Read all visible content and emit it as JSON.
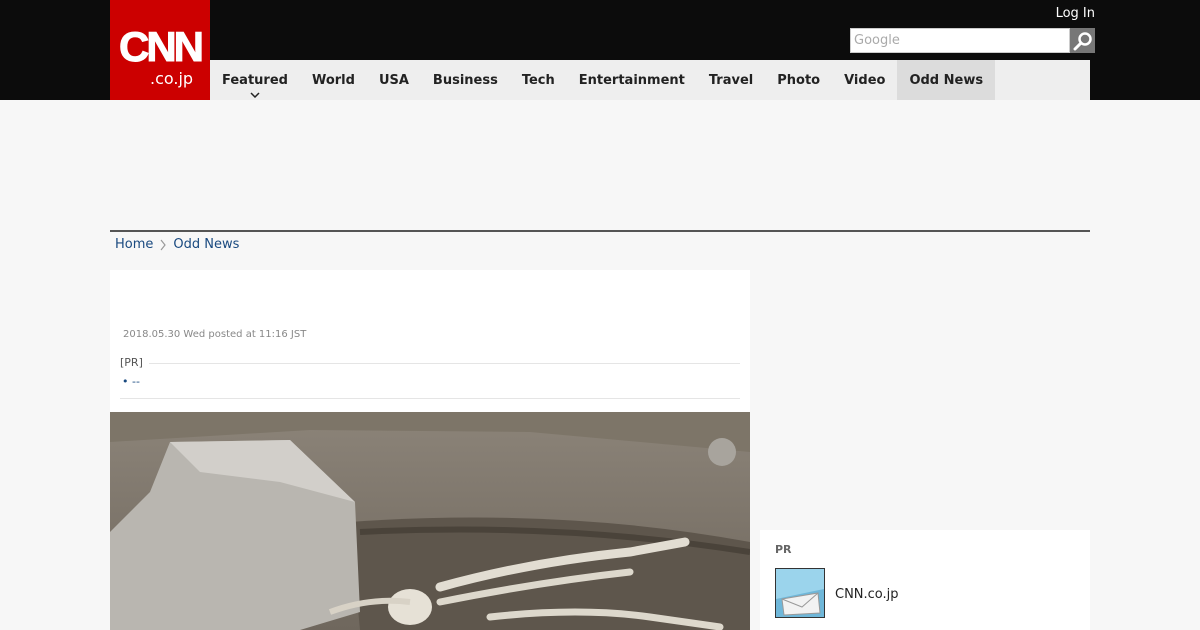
{
  "header": {
    "logo_main": "CNN",
    "logo_sub": ".co.jp",
    "login_label": "Log In",
    "search_placeholder": "Google"
  },
  "nav": {
    "items": [
      "Featured",
      "World",
      "USA",
      "Business",
      "Tech",
      "Entertainment",
      "Travel",
      "Photo",
      "Video",
      "Odd News"
    ],
    "active": "Odd News"
  },
  "breadcrumb": {
    "home": "Home",
    "current": "Odd News"
  },
  "article": {
    "dateline": "2018.05.30 Wed posted at 11:16 JST",
    "pr_label": "[PR]",
    "pr_link": "--"
  },
  "sidebar": {
    "pr_label": "PR",
    "item_label": "CNN.co.jp"
  },
  "colors": {
    "brand_red": "#cc0000",
    "topbar": "#0c0c0c",
    "link": "#1a4a80"
  }
}
